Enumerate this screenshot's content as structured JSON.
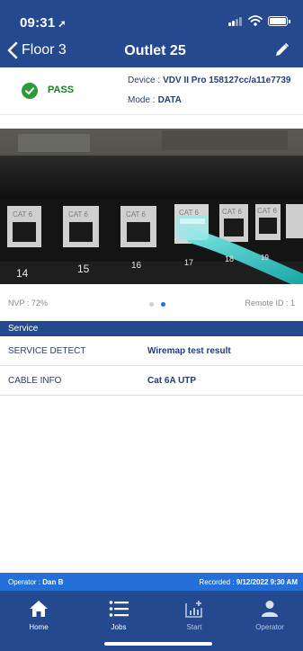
{
  "status_bar": {
    "time": "09:31"
  },
  "nav": {
    "back_label": "Floor 3",
    "title": "Outlet 25"
  },
  "result": {
    "status": "PASS",
    "device_label": "Device :",
    "device_value": "VDV II Pro 158127cc/a11e7739",
    "mode_label": "Mode :",
    "mode_value": "DATA"
  },
  "photo": {
    "port_labels": [
      "CAT 6",
      "CAT 6",
      "CAT 6",
      "CAT 6",
      "CAT 6",
      "CAT 6"
    ],
    "port_numbers": [
      "14",
      "15",
      "16",
      "17",
      "18",
      "19"
    ]
  },
  "photo_meta": {
    "nvp": "NVP : 72%",
    "remote_id": "Remote ID : 1",
    "pager": {
      "count": 2,
      "active_index": 1
    }
  },
  "service": {
    "header": "Service",
    "rows": [
      {
        "label": "SERVICE DETECT",
        "value": "Wiremap test result"
      },
      {
        "label": "CABLE INFO",
        "value": "Cat 6A UTP"
      }
    ]
  },
  "footer": {
    "operator_label": "Operator :",
    "operator_name": "Dan B",
    "recorded_label": "Recorded :",
    "recorded_value": "9/12/2022 9:30 AM"
  },
  "tabs": [
    {
      "label": "Home",
      "icon": "home-icon"
    },
    {
      "label": "Jobs",
      "icon": "list-icon"
    },
    {
      "label": "Start",
      "icon": "chart-plus-icon"
    },
    {
      "label": "Operator",
      "icon": "person-icon"
    }
  ],
  "colors": {
    "header_navy": "#24498f",
    "accent_blue": "#2470d8",
    "pass_green": "#2e9a3c"
  }
}
